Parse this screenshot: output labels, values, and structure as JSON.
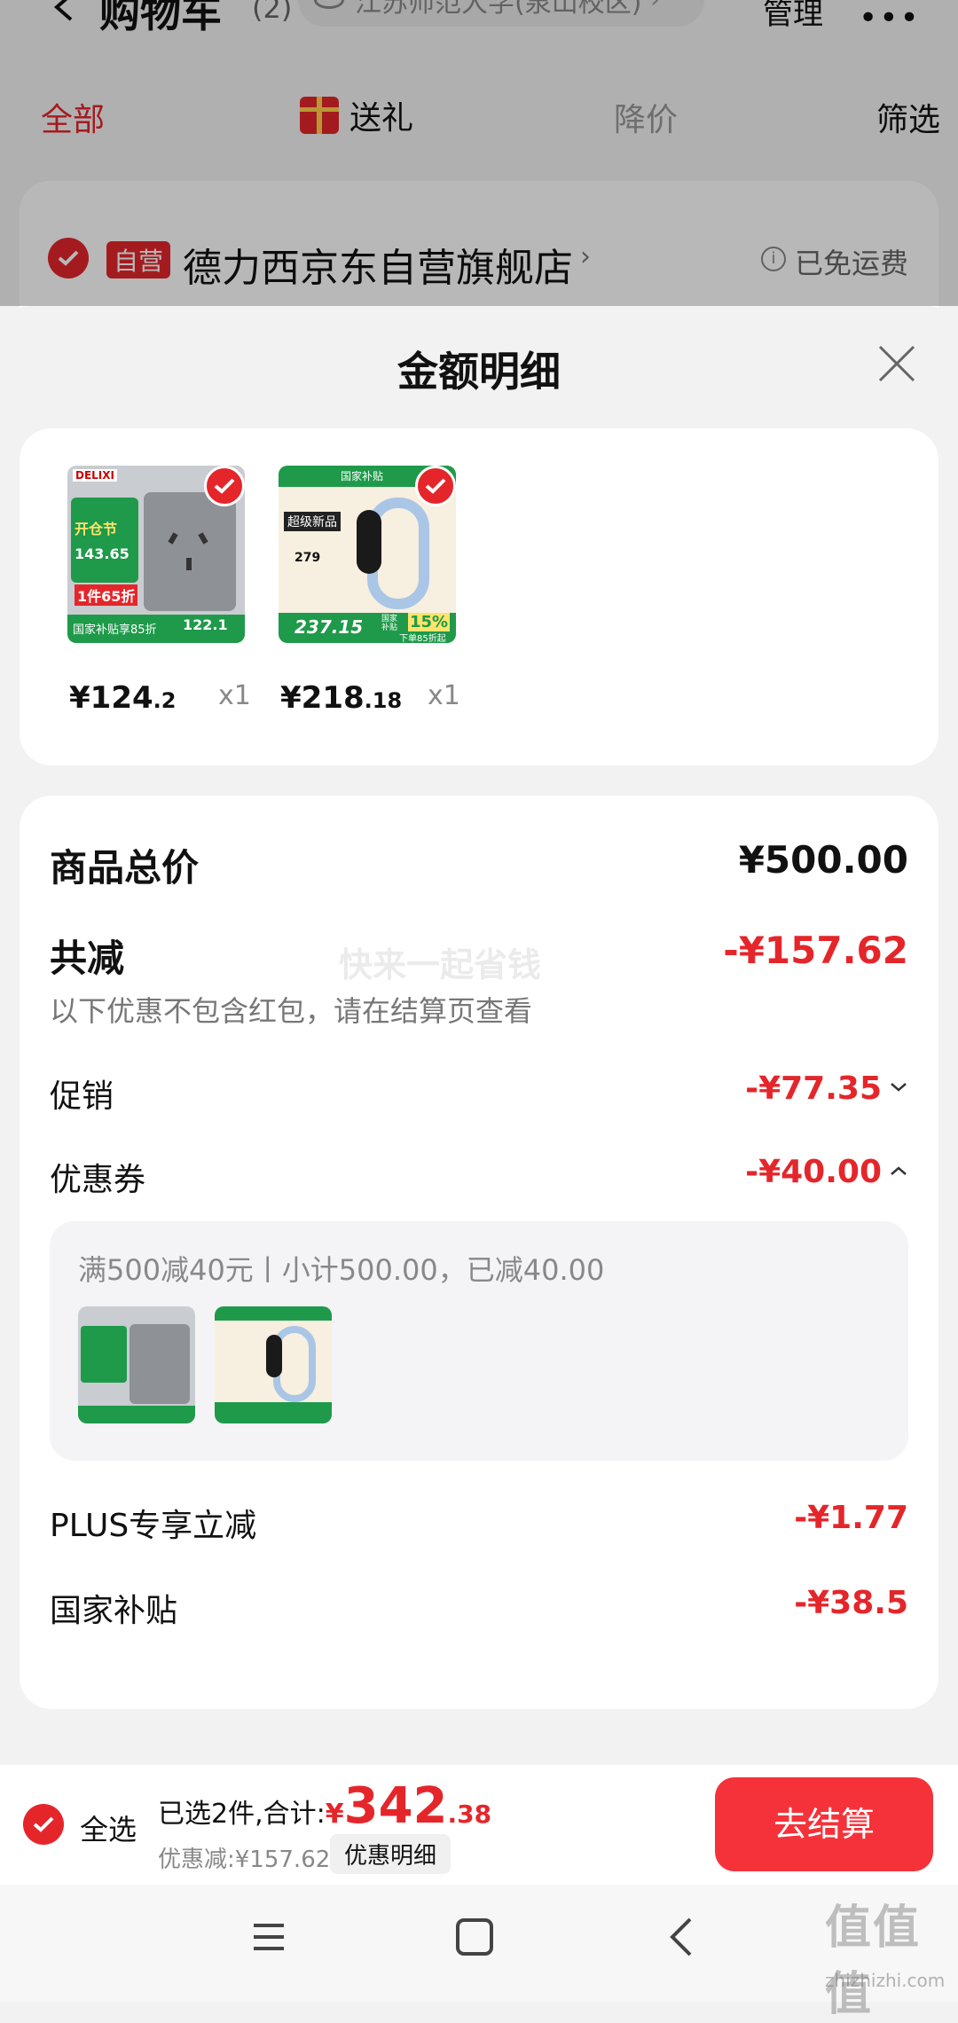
{
  "header": {
    "title": "购物车",
    "count": "(2)",
    "location": "江苏师范大学(泉山校区)",
    "manage": "管理"
  },
  "tabs": [
    {
      "label": "全部"
    },
    {
      "label": "送礼"
    },
    {
      "label": "降价"
    },
    {
      "label": "筛选"
    }
  ],
  "store": {
    "badge": "自营",
    "name": "德力西京东自营旗舰店",
    "shipping": "已免运费"
  },
  "sheet": {
    "title": "金额明细",
    "products": [
      {
        "price_int": "¥124",
        "price_dec": ".2",
        "qty": "x1",
        "img_main": "开仓节",
        "img_price": "143.65",
        "img_tag": "1件65折",
        "img_foot": "国家补贴享85折",
        "img_foot2": "122.1",
        "brand": "DELIXI"
      },
      {
        "price_int": "¥218",
        "price_dec": ".18",
        "qty": "x1",
        "img_top": "国家补贴",
        "img_main": "超级新品",
        "img_price": "279",
        "img_foot": "237.15",
        "img_pct": "15%",
        "img_foot2": "下单85折起",
        "img_sub": "国家补贴"
      }
    ],
    "total_label": "商品总价",
    "total_value": "¥500.00",
    "reduce_label": "共减",
    "reduce_value": "-¥157.62",
    "reduce_note": "以下优惠不包含红包，请在结算页查看",
    "watermark": "快来一起省钱",
    "promo_label": "促销",
    "promo_value": "-¥77.35",
    "coupon_label": "优惠券",
    "coupon_value": "-¥40.00",
    "coupon_detail": "满500减40元丨小计500.00，已减40.00",
    "plus_label": "PLUS专享立减",
    "plus_value": "-¥1.77",
    "subsidy_label": "国家补贴",
    "subsidy_value": "-¥38.5"
  },
  "bottom": {
    "select_all": "全选",
    "selected_text": "已选2件,合计:",
    "currency": "¥",
    "total_int": "342",
    "total_dec": ".38",
    "discount_text": "优惠减:¥157.62",
    "detail_button": "优惠明细",
    "checkout": "去结算"
  },
  "watermark_site": "值值值",
  "watermark_url": "zhizhizhi.com",
  "colors": {
    "accent": "#e4262b",
    "checkout_bg": "#f5323a",
    "green": "#1e9a4a"
  }
}
